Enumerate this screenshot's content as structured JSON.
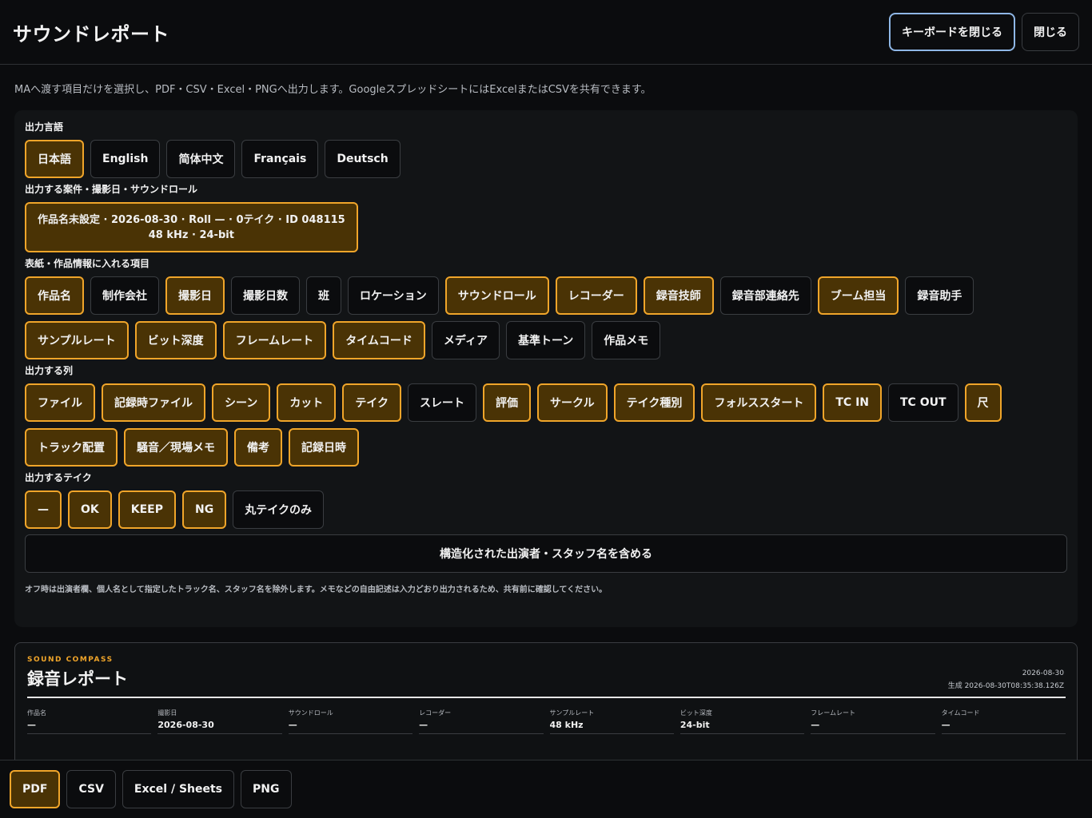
{
  "header": {
    "title": "サウンドレポート",
    "close_keyboard_label": "キーボードを閉じる",
    "close_label": "閉じる"
  },
  "intro": "MAへ渡す項目だけを選択し、PDF・CSV・Excel・PNGへ出力します。GoogleスプレッドシートにはExcelまたはCSVを共有できます。",
  "language": {
    "label": "出力言語",
    "options": [
      {
        "label": "日本語",
        "selected": true
      },
      {
        "label": "English",
        "selected": false
      },
      {
        "label": "简体中文",
        "selected": false
      },
      {
        "label": "Français",
        "selected": false
      },
      {
        "label": "Deutsch",
        "selected": false
      }
    ]
  },
  "project": {
    "label": "出力する案件・撮影日・サウンドロール",
    "line1": "作品名未設定 · 2026-08-30 · Roll — · 0テイク · ID 048115",
    "line2": "48 kHz · 24-bit"
  },
  "cover_items": {
    "label": "表紙・作品情報に入れる項目",
    "items": [
      {
        "label": "作品名",
        "selected": true
      },
      {
        "label": "制作会社",
        "selected": false
      },
      {
        "label": "撮影日",
        "selected": true
      },
      {
        "label": "撮影日数",
        "selected": false
      },
      {
        "label": "班",
        "selected": false
      },
      {
        "label": "ロケーション",
        "selected": false
      },
      {
        "label": "サウンドロール",
        "selected": true
      },
      {
        "label": "レコーダー",
        "selected": true
      },
      {
        "label": "録音技師",
        "selected": true
      },
      {
        "label": "録音部連絡先",
        "selected": false
      },
      {
        "label": "ブーム担当",
        "selected": true
      },
      {
        "label": "録音助手",
        "selected": false
      },
      {
        "label": "サンプルレート",
        "selected": true
      },
      {
        "label": "ビット深度",
        "selected": true
      },
      {
        "label": "フレームレート",
        "selected": true
      },
      {
        "label": "タイムコード",
        "selected": true
      },
      {
        "label": "メディア",
        "selected": false
      },
      {
        "label": "基準トーン",
        "selected": false
      },
      {
        "label": "作品メモ",
        "selected": false
      }
    ]
  },
  "columns": {
    "label": "出力する列",
    "items": [
      {
        "label": "ファイル",
        "selected": true
      },
      {
        "label": "記録時ファイル",
        "selected": true
      },
      {
        "label": "シーン",
        "selected": true
      },
      {
        "label": "カット",
        "selected": true
      },
      {
        "label": "テイク",
        "selected": true
      },
      {
        "label": "スレート",
        "selected": false
      },
      {
        "label": "評価",
        "selected": true
      },
      {
        "label": "サークル",
        "selected": true
      },
      {
        "label": "テイク種別",
        "selected": true
      },
      {
        "label": "フォルススタート",
        "selected": true
      },
      {
        "label": "TC IN",
        "selected": true
      },
      {
        "label": "TC OUT",
        "selected": false
      },
      {
        "label": "尺",
        "selected": true
      },
      {
        "label": "トラック配置",
        "selected": true
      },
      {
        "label": "騒音／現場メモ",
        "selected": true
      },
      {
        "label": "備考",
        "selected": true
      },
      {
        "label": "記録日時",
        "selected": true
      }
    ]
  },
  "takes": {
    "label": "出力するテイク",
    "items": [
      {
        "label": "—",
        "selected": true
      },
      {
        "label": "OK",
        "selected": true
      },
      {
        "label": "KEEP",
        "selected": true
      },
      {
        "label": "NG",
        "selected": true
      },
      {
        "label": "丸テイクのみ",
        "selected": false
      }
    ]
  },
  "include_names_label": "構造化された出演者・スタッフ名を含める",
  "note": "オフ時は出演者欄、個人名として指定したトラック名、スタッフ名を除外します。メモなどの自由記述は入力どおり出力されるため、共有前に確認してください。",
  "report": {
    "brand": "SOUND COMPASS",
    "title": "録音レポート",
    "date": "2026-08-30",
    "generated": "生成 2026-08-30T08:35:38.126Z",
    "fields": [
      {
        "label": "作品名",
        "value": "—"
      },
      {
        "label": "撮影日",
        "value": "2026-08-30"
      },
      {
        "label": "サウンドロール",
        "value": "—"
      },
      {
        "label": "レコーダー",
        "value": "—"
      },
      {
        "label": "サンプルレート",
        "value": "48 kHz"
      },
      {
        "label": "ビット深度",
        "value": "24-bit"
      },
      {
        "label": "フレームレート",
        "value": "—"
      },
      {
        "label": "タイムコード",
        "value": "—"
      }
    ]
  },
  "export": {
    "items": [
      {
        "label": "PDF",
        "selected": true
      },
      {
        "label": "CSV",
        "selected": false
      },
      {
        "label": "Excel / Sheets",
        "selected": false
      },
      {
        "label": "PNG",
        "selected": false
      }
    ]
  },
  "colors": {
    "accent": "#f0a52a",
    "selected_bg": "#4a3305",
    "focus": "#8fb7e6",
    "background": "#0b0c0e"
  }
}
